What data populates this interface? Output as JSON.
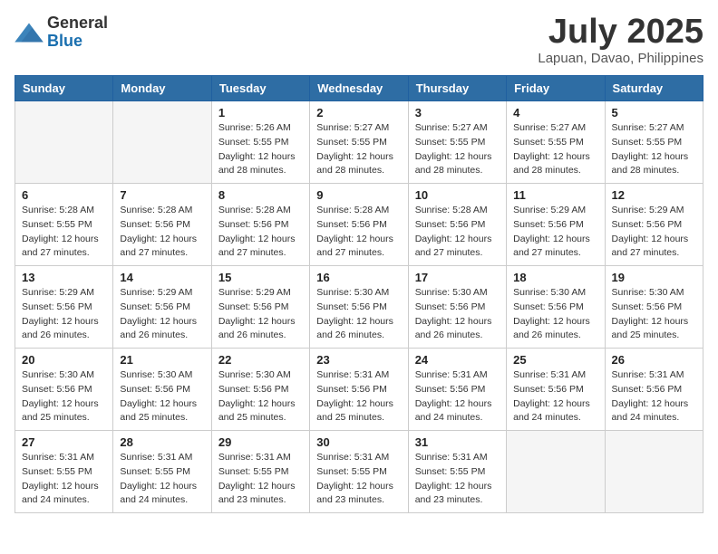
{
  "header": {
    "logo_general": "General",
    "logo_blue": "Blue",
    "title": "July 2025",
    "location": "Lapuan, Davao, Philippines"
  },
  "days_of_week": [
    "Sunday",
    "Monday",
    "Tuesday",
    "Wednesday",
    "Thursday",
    "Friday",
    "Saturday"
  ],
  "weeks": [
    [
      {
        "day": "",
        "empty": true
      },
      {
        "day": "",
        "empty": true
      },
      {
        "day": "1",
        "sunrise": "Sunrise: 5:26 AM",
        "sunset": "Sunset: 5:55 PM",
        "daylight": "Daylight: 12 hours and 28 minutes."
      },
      {
        "day": "2",
        "sunrise": "Sunrise: 5:27 AM",
        "sunset": "Sunset: 5:55 PM",
        "daylight": "Daylight: 12 hours and 28 minutes."
      },
      {
        "day": "3",
        "sunrise": "Sunrise: 5:27 AM",
        "sunset": "Sunset: 5:55 PM",
        "daylight": "Daylight: 12 hours and 28 minutes."
      },
      {
        "day": "4",
        "sunrise": "Sunrise: 5:27 AM",
        "sunset": "Sunset: 5:55 PM",
        "daylight": "Daylight: 12 hours and 28 minutes."
      },
      {
        "day": "5",
        "sunrise": "Sunrise: 5:27 AM",
        "sunset": "Sunset: 5:55 PM",
        "daylight": "Daylight: 12 hours and 28 minutes."
      }
    ],
    [
      {
        "day": "6",
        "sunrise": "Sunrise: 5:28 AM",
        "sunset": "Sunset: 5:55 PM",
        "daylight": "Daylight: 12 hours and 27 minutes."
      },
      {
        "day": "7",
        "sunrise": "Sunrise: 5:28 AM",
        "sunset": "Sunset: 5:56 PM",
        "daylight": "Daylight: 12 hours and 27 minutes."
      },
      {
        "day": "8",
        "sunrise": "Sunrise: 5:28 AM",
        "sunset": "Sunset: 5:56 PM",
        "daylight": "Daylight: 12 hours and 27 minutes."
      },
      {
        "day": "9",
        "sunrise": "Sunrise: 5:28 AM",
        "sunset": "Sunset: 5:56 PM",
        "daylight": "Daylight: 12 hours and 27 minutes."
      },
      {
        "day": "10",
        "sunrise": "Sunrise: 5:28 AM",
        "sunset": "Sunset: 5:56 PM",
        "daylight": "Daylight: 12 hours and 27 minutes."
      },
      {
        "day": "11",
        "sunrise": "Sunrise: 5:29 AM",
        "sunset": "Sunset: 5:56 PM",
        "daylight": "Daylight: 12 hours and 27 minutes."
      },
      {
        "day": "12",
        "sunrise": "Sunrise: 5:29 AM",
        "sunset": "Sunset: 5:56 PM",
        "daylight": "Daylight: 12 hours and 27 minutes."
      }
    ],
    [
      {
        "day": "13",
        "sunrise": "Sunrise: 5:29 AM",
        "sunset": "Sunset: 5:56 PM",
        "daylight": "Daylight: 12 hours and 26 minutes."
      },
      {
        "day": "14",
        "sunrise": "Sunrise: 5:29 AM",
        "sunset": "Sunset: 5:56 PM",
        "daylight": "Daylight: 12 hours and 26 minutes."
      },
      {
        "day": "15",
        "sunrise": "Sunrise: 5:29 AM",
        "sunset": "Sunset: 5:56 PM",
        "daylight": "Daylight: 12 hours and 26 minutes."
      },
      {
        "day": "16",
        "sunrise": "Sunrise: 5:30 AM",
        "sunset": "Sunset: 5:56 PM",
        "daylight": "Daylight: 12 hours and 26 minutes."
      },
      {
        "day": "17",
        "sunrise": "Sunrise: 5:30 AM",
        "sunset": "Sunset: 5:56 PM",
        "daylight": "Daylight: 12 hours and 26 minutes."
      },
      {
        "day": "18",
        "sunrise": "Sunrise: 5:30 AM",
        "sunset": "Sunset: 5:56 PM",
        "daylight": "Daylight: 12 hours and 26 minutes."
      },
      {
        "day": "19",
        "sunrise": "Sunrise: 5:30 AM",
        "sunset": "Sunset: 5:56 PM",
        "daylight": "Daylight: 12 hours and 25 minutes."
      }
    ],
    [
      {
        "day": "20",
        "sunrise": "Sunrise: 5:30 AM",
        "sunset": "Sunset: 5:56 PM",
        "daylight": "Daylight: 12 hours and 25 minutes."
      },
      {
        "day": "21",
        "sunrise": "Sunrise: 5:30 AM",
        "sunset": "Sunset: 5:56 PM",
        "daylight": "Daylight: 12 hours and 25 minutes."
      },
      {
        "day": "22",
        "sunrise": "Sunrise: 5:30 AM",
        "sunset": "Sunset: 5:56 PM",
        "daylight": "Daylight: 12 hours and 25 minutes."
      },
      {
        "day": "23",
        "sunrise": "Sunrise: 5:31 AM",
        "sunset": "Sunset: 5:56 PM",
        "daylight": "Daylight: 12 hours and 25 minutes."
      },
      {
        "day": "24",
        "sunrise": "Sunrise: 5:31 AM",
        "sunset": "Sunset: 5:56 PM",
        "daylight": "Daylight: 12 hours and 24 minutes."
      },
      {
        "day": "25",
        "sunrise": "Sunrise: 5:31 AM",
        "sunset": "Sunset: 5:56 PM",
        "daylight": "Daylight: 12 hours and 24 minutes."
      },
      {
        "day": "26",
        "sunrise": "Sunrise: 5:31 AM",
        "sunset": "Sunset: 5:56 PM",
        "daylight": "Daylight: 12 hours and 24 minutes."
      }
    ],
    [
      {
        "day": "27",
        "sunrise": "Sunrise: 5:31 AM",
        "sunset": "Sunset: 5:55 PM",
        "daylight": "Daylight: 12 hours and 24 minutes."
      },
      {
        "day": "28",
        "sunrise": "Sunrise: 5:31 AM",
        "sunset": "Sunset: 5:55 PM",
        "daylight": "Daylight: 12 hours and 24 minutes."
      },
      {
        "day": "29",
        "sunrise": "Sunrise: 5:31 AM",
        "sunset": "Sunset: 5:55 PM",
        "daylight": "Daylight: 12 hours and 23 minutes."
      },
      {
        "day": "30",
        "sunrise": "Sunrise: 5:31 AM",
        "sunset": "Sunset: 5:55 PM",
        "daylight": "Daylight: 12 hours and 23 minutes."
      },
      {
        "day": "31",
        "sunrise": "Sunrise: 5:31 AM",
        "sunset": "Sunset: 5:55 PM",
        "daylight": "Daylight: 12 hours and 23 minutes."
      },
      {
        "day": "",
        "empty": true
      },
      {
        "day": "",
        "empty": true
      }
    ]
  ]
}
